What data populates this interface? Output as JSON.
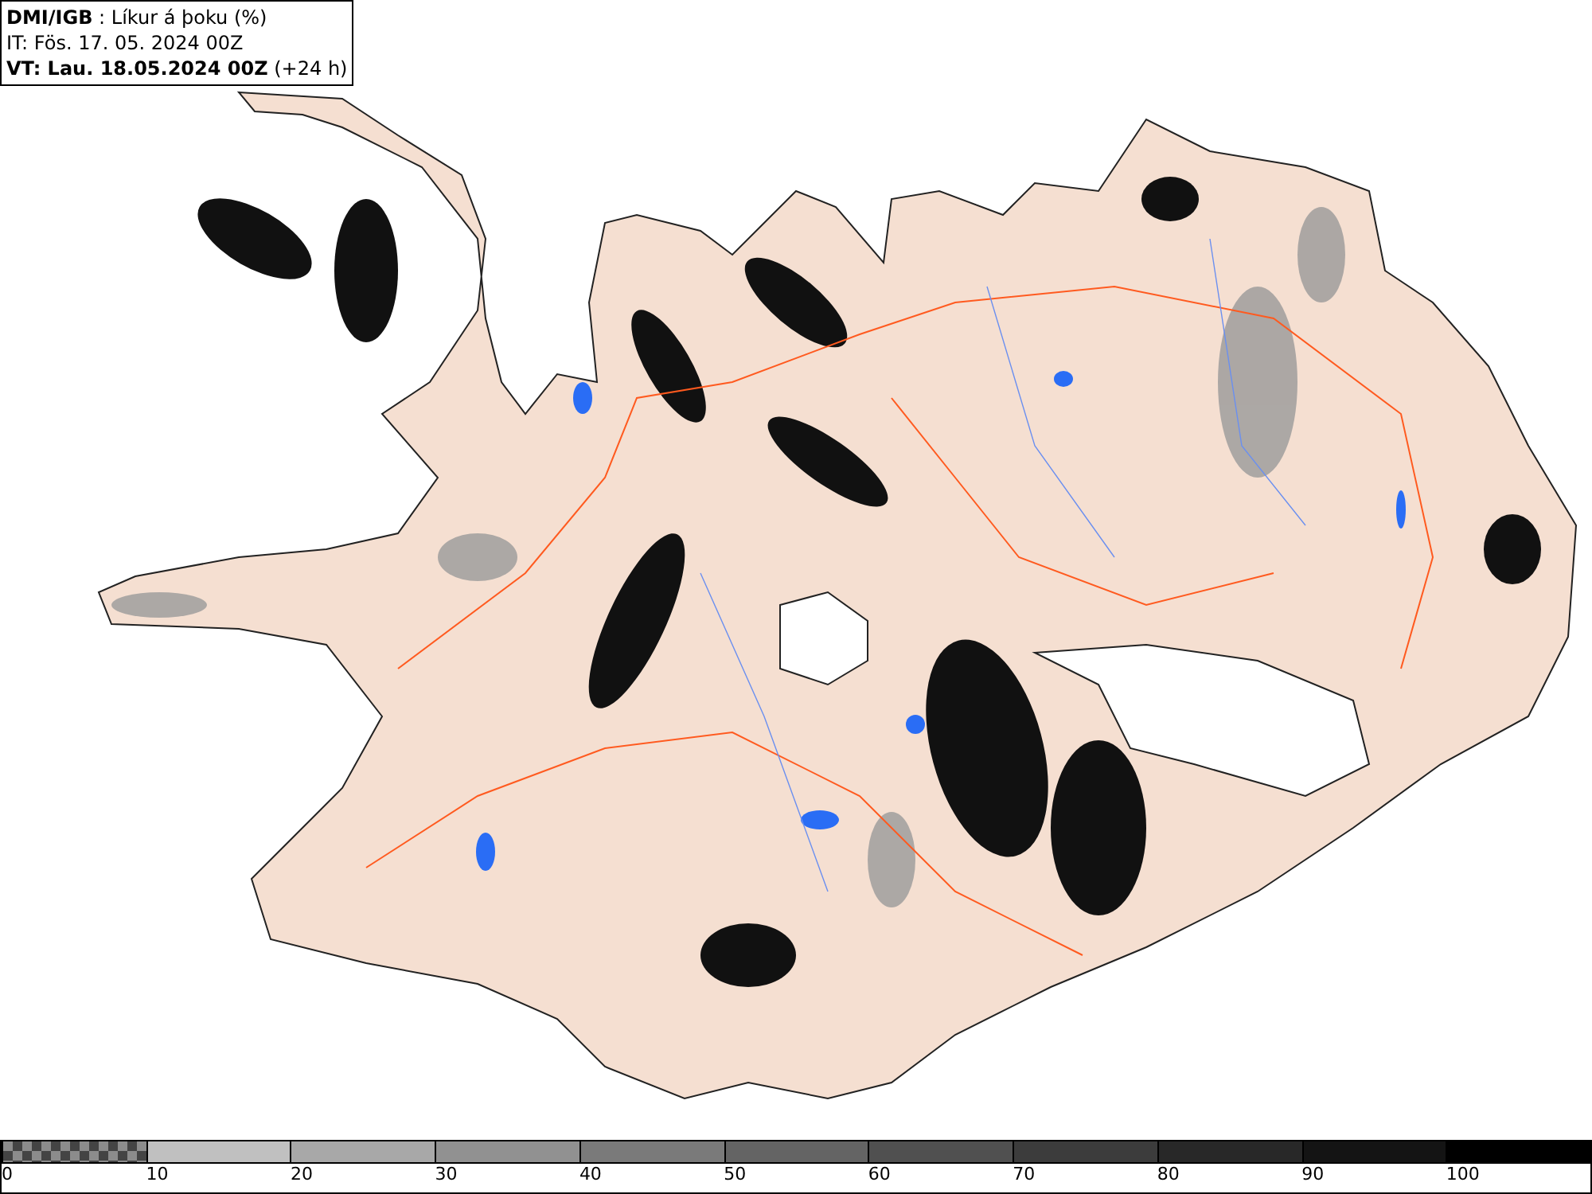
{
  "header": {
    "title": "**DMI/IGB** : Líkur á þoku (%)",
    "issue_time": "IT: Fös. 17. 05. 2024 00Z",
    "valid_time": "**VT: Lau. 18.05.2024 00Z** (+24 h)"
  },
  "legend": {
    "segments": [
      {
        "kind": "pattern",
        "color": "#8c8c8c",
        "label": "0"
      },
      {
        "kind": "solid",
        "color": "#c0c0c0",
        "label": "10"
      },
      {
        "kind": "solid",
        "color": "#a8a8a8",
        "label": "20"
      },
      {
        "kind": "solid",
        "color": "#919191",
        "label": "30"
      },
      {
        "kind": "solid",
        "color": "#7a7a7a",
        "label": "40"
      },
      {
        "kind": "solid",
        "color": "#646464",
        "label": "50"
      },
      {
        "kind": "solid",
        "color": "#505050",
        "label": "60"
      },
      {
        "kind": "solid",
        "color": "#3c3c3c",
        "label": "70"
      },
      {
        "kind": "solid",
        "color": "#282828",
        "label": "80"
      },
      {
        "kind": "solid",
        "color": "#141414",
        "label": "90"
      },
      {
        "kind": "solid",
        "color": "#000000",
        "label": "100"
      }
    ]
  }
}
